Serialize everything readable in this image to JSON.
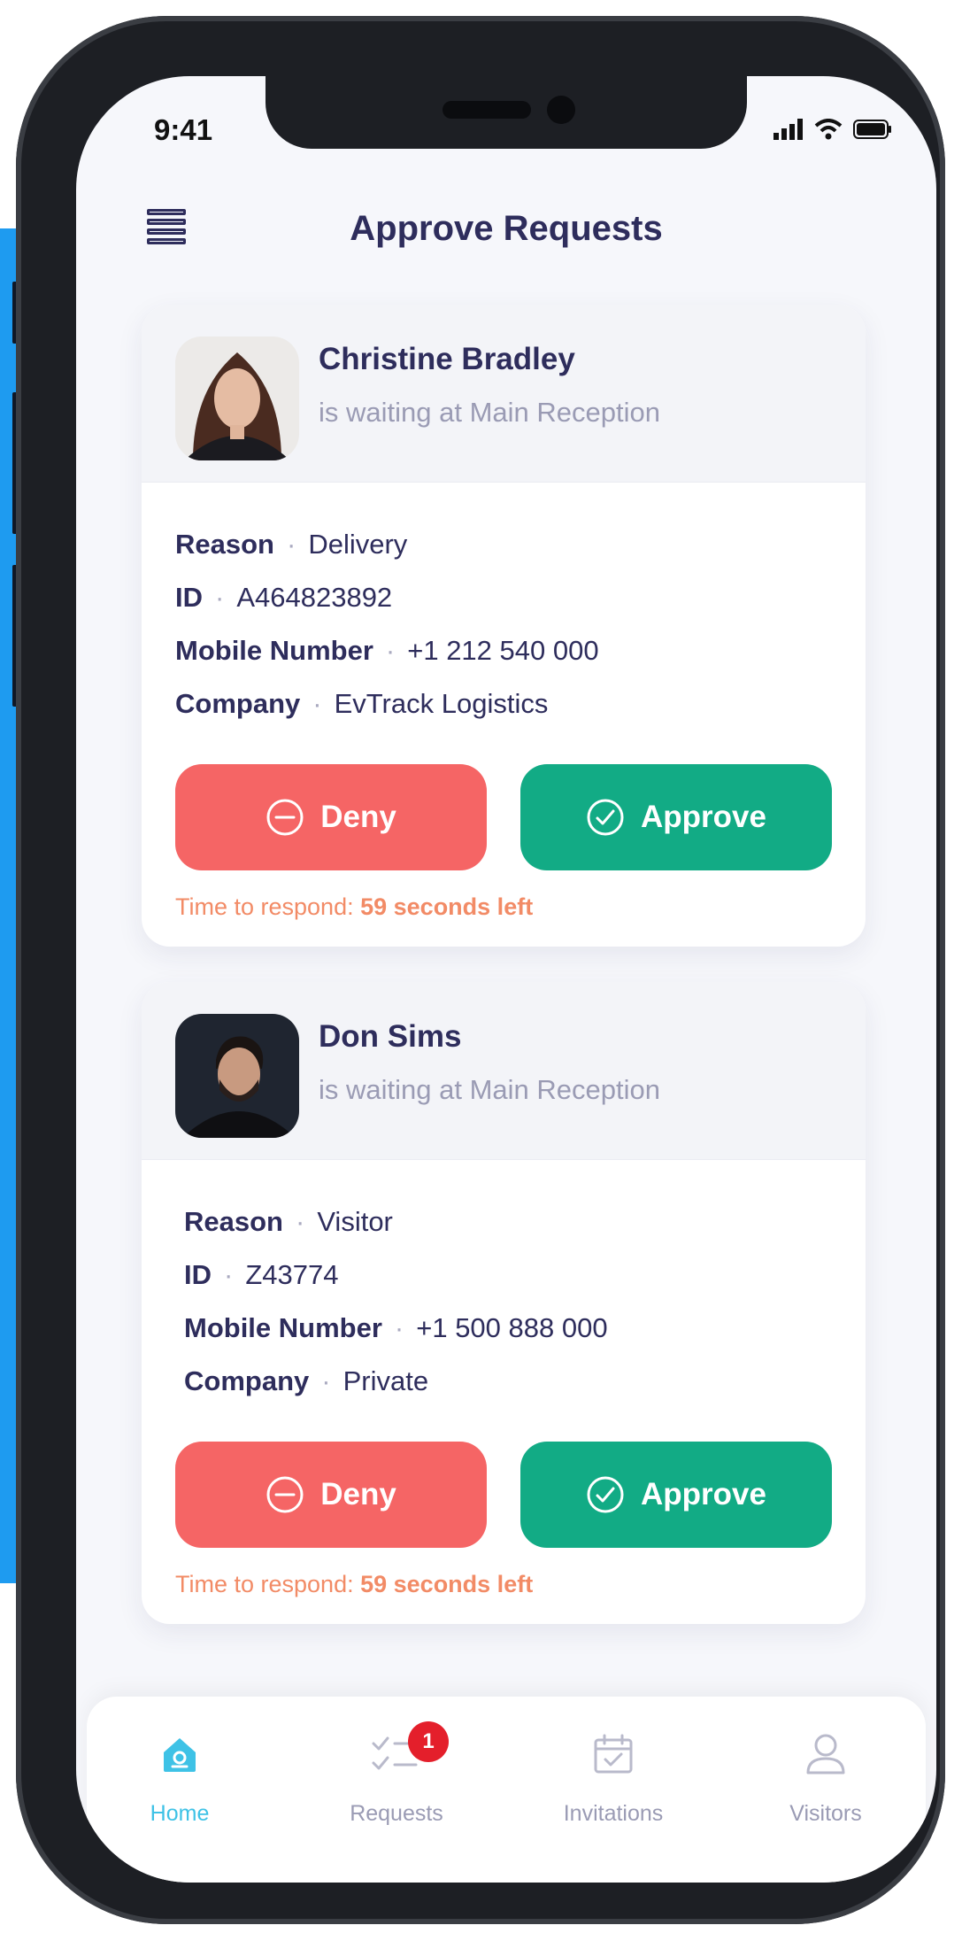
{
  "status_bar": {
    "time": "9:41"
  },
  "header": {
    "title": "Approve Requests"
  },
  "requests": [
    {
      "name": "Christine Bradley",
      "status": "is waiting at Main Reception",
      "details": [
        {
          "label": "Reason",
          "value": "Delivery"
        },
        {
          "label": "ID",
          "value": "A464823892"
        },
        {
          "label": "Mobile Number",
          "value": "+1 212 540 000"
        },
        {
          "label": "Company",
          "value": "EvTrack Logistics"
        }
      ],
      "deny_label": "Deny",
      "approve_label": "Approve",
      "timer_prefix": "Time to respond:",
      "timer_value": "59 seconds left"
    },
    {
      "name": "Don Sims",
      "status": "is waiting at Main Reception",
      "details": [
        {
          "label": "Reason",
          "value": "Visitor"
        },
        {
          "label": "ID",
          "value": "Z43774"
        },
        {
          "label": "Mobile Number",
          "value": "+1 500 888 000"
        },
        {
          "label": "Company",
          "value": "Private"
        }
      ],
      "deny_label": "Deny",
      "approve_label": "Approve",
      "timer_prefix": "Time to respond:",
      "timer_value": "59 seconds left"
    }
  ],
  "separator": "·",
  "tabs": [
    {
      "label": "Home",
      "icon": "home-icon",
      "active": true
    },
    {
      "label": "Requests",
      "icon": "checklist-icon",
      "badge": "1"
    },
    {
      "label": "Invitations",
      "icon": "calendar-icon"
    },
    {
      "label": "Visitors",
      "icon": "user-icon"
    }
  ],
  "colors": {
    "deny": "#f56565",
    "approve": "#12ab85",
    "title": "#2e2d5c",
    "active_tab": "#3ec2e6",
    "timer": "#f28b66",
    "badge": "#e41f2b"
  }
}
